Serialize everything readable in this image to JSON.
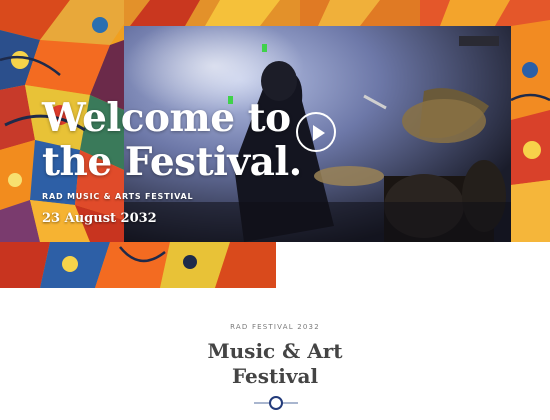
{
  "hero": {
    "title_line1": "Welcome to",
    "title_line2": "the Festival.",
    "eyebrow": "RAD MUSIC & ARTS FESTIVAL",
    "date": "23 August 2032"
  },
  "video": {
    "play_icon": "play-icon"
  },
  "intro": {
    "eyebrow": "RAD FESTIVAL 2032",
    "title_line1": "Music & Art",
    "title_line2": "Festival"
  },
  "colors": {
    "accent": "#233b7a",
    "divider": "#a9b6cf",
    "heading": "#444444",
    "muted": "#7a7a7a"
  }
}
